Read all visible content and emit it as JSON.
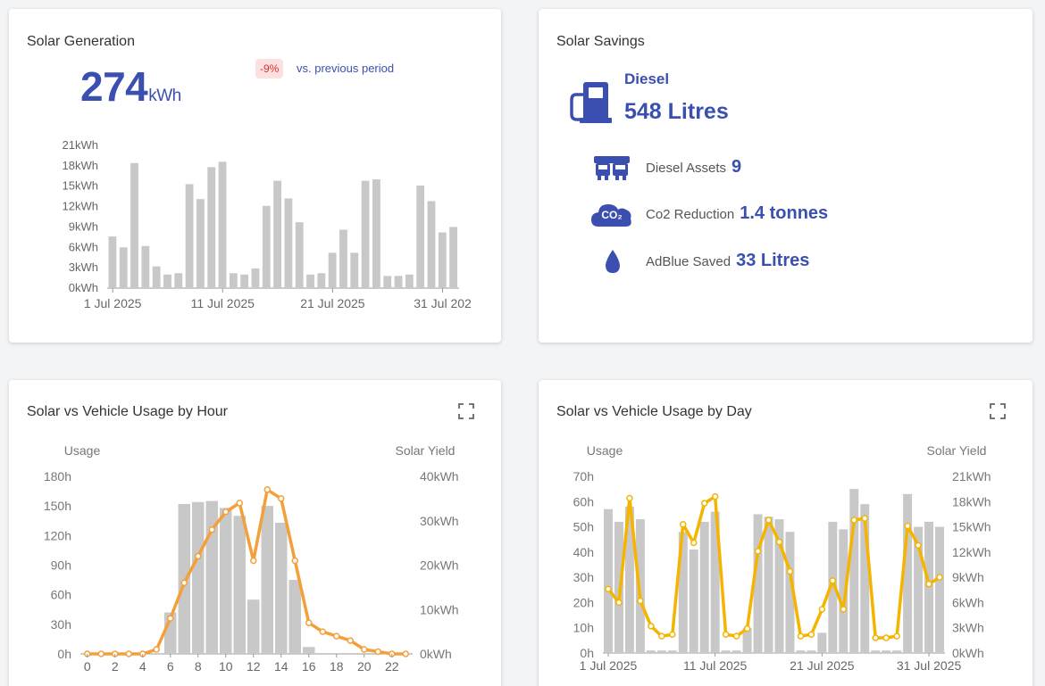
{
  "generation": {
    "title": "Solar Generation",
    "value": "274",
    "unit": "kWh",
    "change": "-9%",
    "change_text": "vs. previous period"
  },
  "savings": {
    "title": "Solar Savings",
    "fuel_label": "Diesel",
    "fuel_value": "548 Litres",
    "rows": [
      {
        "label": "Diesel Assets",
        "value": "9",
        "icon": "truck-fleet-icon"
      },
      {
        "label": "Co2 Reduction",
        "value": "1.4 tonnes",
        "icon": "co2-cloud-icon"
      },
      {
        "label": "AdBlue Saved",
        "value": "33 Litres",
        "icon": "water-drop-icon"
      }
    ],
    "fuel_icon": "fuel-pump-icon",
    "co2_icon_text": "CO₂"
  },
  "hour_card": {
    "title": "Solar vs Vehicle Usage by Hour"
  },
  "day_card": {
    "title": "Solar vs Vehicle Usage by Day"
  },
  "colors": {
    "accent": "#3b4fb0",
    "bar": "#c8c8c8",
    "line_hour": "#f4a03a",
    "line_day": "#f5b400",
    "negative": "#e03030"
  },
  "chart_data": [
    {
      "id": "generation",
      "type": "bar",
      "ylabel": "",
      "ylim": [
        0,
        21
      ],
      "y_ticks": [
        "0kWh",
        "3kWh",
        "6kWh",
        "9kWh",
        "12kWh",
        "15kWh",
        "18kWh",
        "21kWh"
      ],
      "x_tick_labels": [
        "1 Jul 2025",
        "11 Jul 2025",
        "21 Jul 2025",
        "31 Jul 202"
      ],
      "x_tick_index": [
        0,
        10,
        20,
        30
      ],
      "dates": [
        "2025-07-01",
        "2025-07-02",
        "2025-07-03",
        "2025-07-04",
        "2025-07-05",
        "2025-07-06",
        "2025-07-07",
        "2025-07-08",
        "2025-07-09",
        "2025-07-10",
        "2025-07-11",
        "2025-07-12",
        "2025-07-13",
        "2025-07-14",
        "2025-07-15",
        "2025-07-16",
        "2025-07-17",
        "2025-07-18",
        "2025-07-19",
        "2025-07-20",
        "2025-07-21",
        "2025-07-22",
        "2025-07-23",
        "2025-07-24",
        "2025-07-25",
        "2025-07-26",
        "2025-07-27",
        "2025-07-28",
        "2025-07-29",
        "2025-07-30",
        "2025-07-31",
        "2025-08-01"
      ],
      "values": [
        7.6,
        6,
        18.4,
        6.2,
        3.2,
        2,
        2.2,
        15.3,
        13.1,
        17.8,
        18.6,
        2.2,
        2,
        2.9,
        12.1,
        15.8,
        13.2,
        9.7,
        2,
        2.2,
        5.2,
        8.6,
        5.2,
        15.8,
        16,
        1.8,
        1.8,
        2,
        15.1,
        12.8,
        8.2,
        9
      ]
    },
    {
      "id": "by-hour",
      "type": "bar",
      "ylabel": "Usage",
      "y2label": "Solar Yield",
      "ylim": [
        0,
        180
      ],
      "y2lim": [
        0,
        40
      ],
      "y_ticks": [
        "0h",
        "30h",
        "60h",
        "90h",
        "120h",
        "150h",
        "180h"
      ],
      "y2_ticks": [
        "0kWh",
        "10kWh",
        "20kWh",
        "30kWh",
        "40kWh"
      ],
      "x": [
        0,
        1,
        2,
        3,
        4,
        5,
        6,
        7,
        8,
        9,
        10,
        11,
        12,
        13,
        14,
        15,
        16,
        17,
        18,
        19,
        20,
        21,
        22,
        23
      ],
      "x_tick_labels": [
        "0",
        "2",
        "4",
        "6",
        "8",
        "10",
        "12",
        "14",
        "16",
        "18",
        "20",
        "22"
      ],
      "series": [
        {
          "values": [
            0,
            0,
            0,
            0,
            0,
            0,
            42,
            152,
            154,
            155,
            148,
            140,
            55,
            150,
            133,
            75,
            7,
            0,
            0,
            0,
            0,
            0,
            0,
            0
          ]
        },
        {
          "values": [
            0,
            0,
            0,
            0,
            0,
            1,
            8,
            16,
            22,
            28,
            32,
            34,
            21,
            37,
            35,
            21,
            7,
            5,
            4,
            3,
            1,
            0.5,
            0,
            0
          ]
        }
      ]
    },
    {
      "id": "by-day",
      "type": "bar",
      "ylabel": "Usage",
      "y2label": "Solar Yield",
      "ylim": [
        0,
        70
      ],
      "y2lim": [
        0,
        21
      ],
      "y_ticks": [
        "0h",
        "10h",
        "20h",
        "30h",
        "40h",
        "50h",
        "60h",
        "70h"
      ],
      "y2_ticks": [
        "0kWh",
        "3kWh",
        "6kWh",
        "9kWh",
        "12kWh",
        "15kWh",
        "18kWh",
        "21kWh"
      ],
      "dates": [
        "2025-07-01",
        "2025-07-02",
        "2025-07-03",
        "2025-07-04",
        "2025-07-05",
        "2025-07-06",
        "2025-07-07",
        "2025-07-08",
        "2025-07-09",
        "2025-07-10",
        "2025-07-11",
        "2025-07-12",
        "2025-07-13",
        "2025-07-14",
        "2025-07-15",
        "2025-07-16",
        "2025-07-17",
        "2025-07-18",
        "2025-07-19",
        "2025-07-20",
        "2025-07-21",
        "2025-07-22",
        "2025-07-23",
        "2025-07-24",
        "2025-07-25",
        "2025-07-26",
        "2025-07-27",
        "2025-07-28",
        "2025-07-29",
        "2025-07-30",
        "2025-07-31",
        "2025-08-01"
      ],
      "x_tick_labels": [
        "1 Jul 2025",
        "11 Jul 2025",
        "21 Jul 2025",
        "31 Jul 2025"
      ],
      "x_tick_index": [
        0,
        10,
        20,
        30
      ],
      "series": [
        {
          "values": [
            57,
            52,
            58,
            53,
            1,
            1,
            1,
            48,
            41,
            52,
            56,
            1,
            1,
            10,
            55,
            54,
            53,
            48,
            1,
            1,
            8,
            52,
            49,
            65,
            59,
            1,
            1,
            1,
            63,
            50,
            52,
            50
          ]
        },
        {
          "values": [
            7.6,
            6,
            18.4,
            6.2,
            3.2,
            2,
            2.2,
            15.3,
            13.1,
            17.8,
            18.6,
            2.2,
            2,
            2.9,
            12.1,
            15.8,
            13.2,
            9.7,
            2,
            2.2,
            5.2,
            8.6,
            5.2,
            15.8,
            16,
            1.8,
            1.8,
            2,
            15.1,
            12.8,
            8.2,
            9
          ]
        }
      ]
    }
  ]
}
